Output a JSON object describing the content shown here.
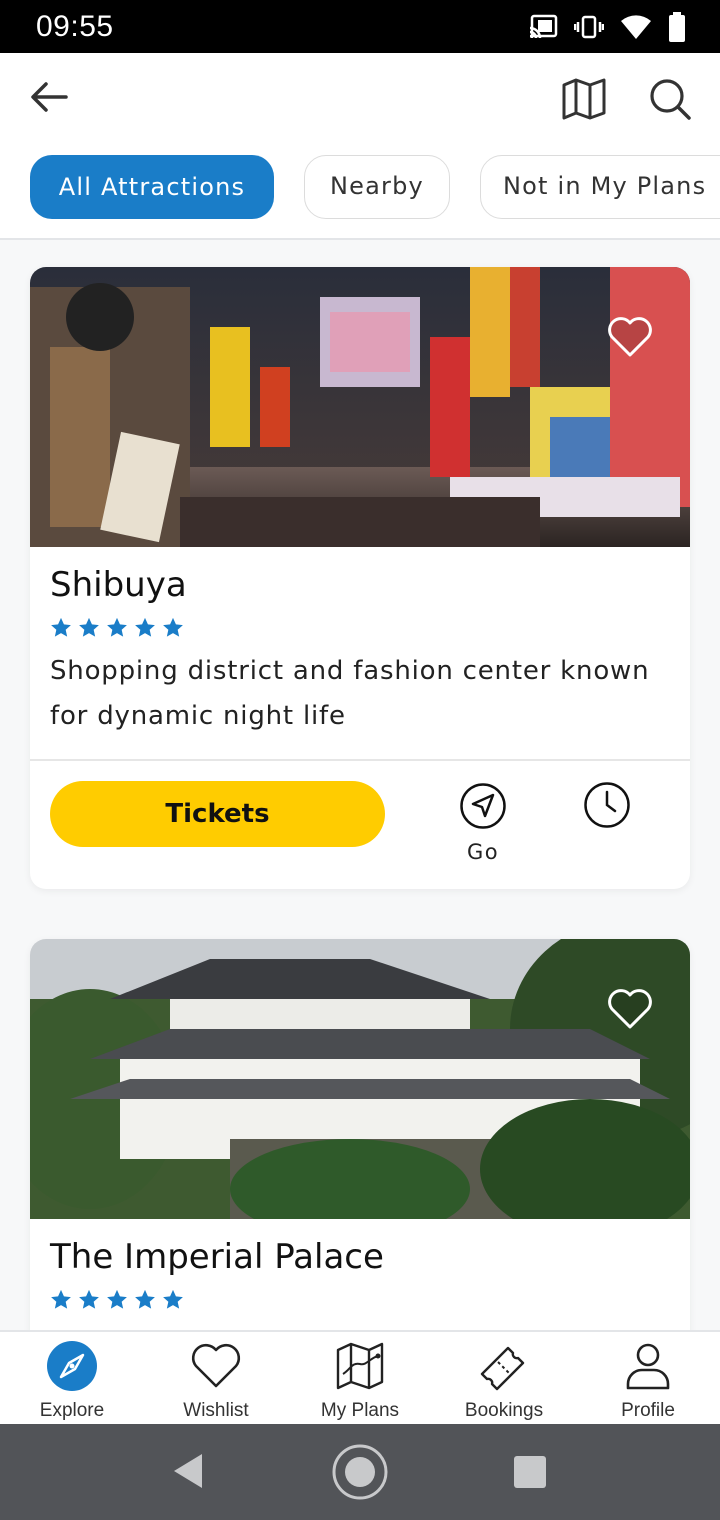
{
  "status_bar": {
    "time": "09:55"
  },
  "filters": {
    "all": "All Attractions",
    "nearby": "Nearby",
    "not_in_plan": "Not in My Plans",
    "active": "All Attractions"
  },
  "colors": {
    "accent": "#1a7dc8",
    "tickets": "#ffcc00",
    "star": "#1a7dc8"
  },
  "icons": {
    "back": "back-arrow-icon",
    "map": "map-icon",
    "search": "search-icon",
    "heart": "heart-outline-icon",
    "go": "navigation-arrow-icon",
    "clock": "clock-icon"
  },
  "attractions": [
    {
      "name": "Shibuya",
      "rating": 5,
      "description": "Shopping district and fashion center known for dynamic night life",
      "tickets_label": "Tickets",
      "go_label": "Go"
    },
    {
      "name": "The Imperial Palace",
      "rating": 5
    }
  ],
  "bottom_nav": [
    {
      "label": "Explore",
      "icon": "compass-icon",
      "active": true
    },
    {
      "label": "Wishlist",
      "icon": "heart-icon",
      "active": false
    },
    {
      "label": "My Plans",
      "icon": "map-route-icon",
      "active": false
    },
    {
      "label": "Bookings",
      "icon": "ticket-icon",
      "active": false
    },
    {
      "label": "Profile",
      "icon": "user-icon",
      "active": false
    }
  ]
}
